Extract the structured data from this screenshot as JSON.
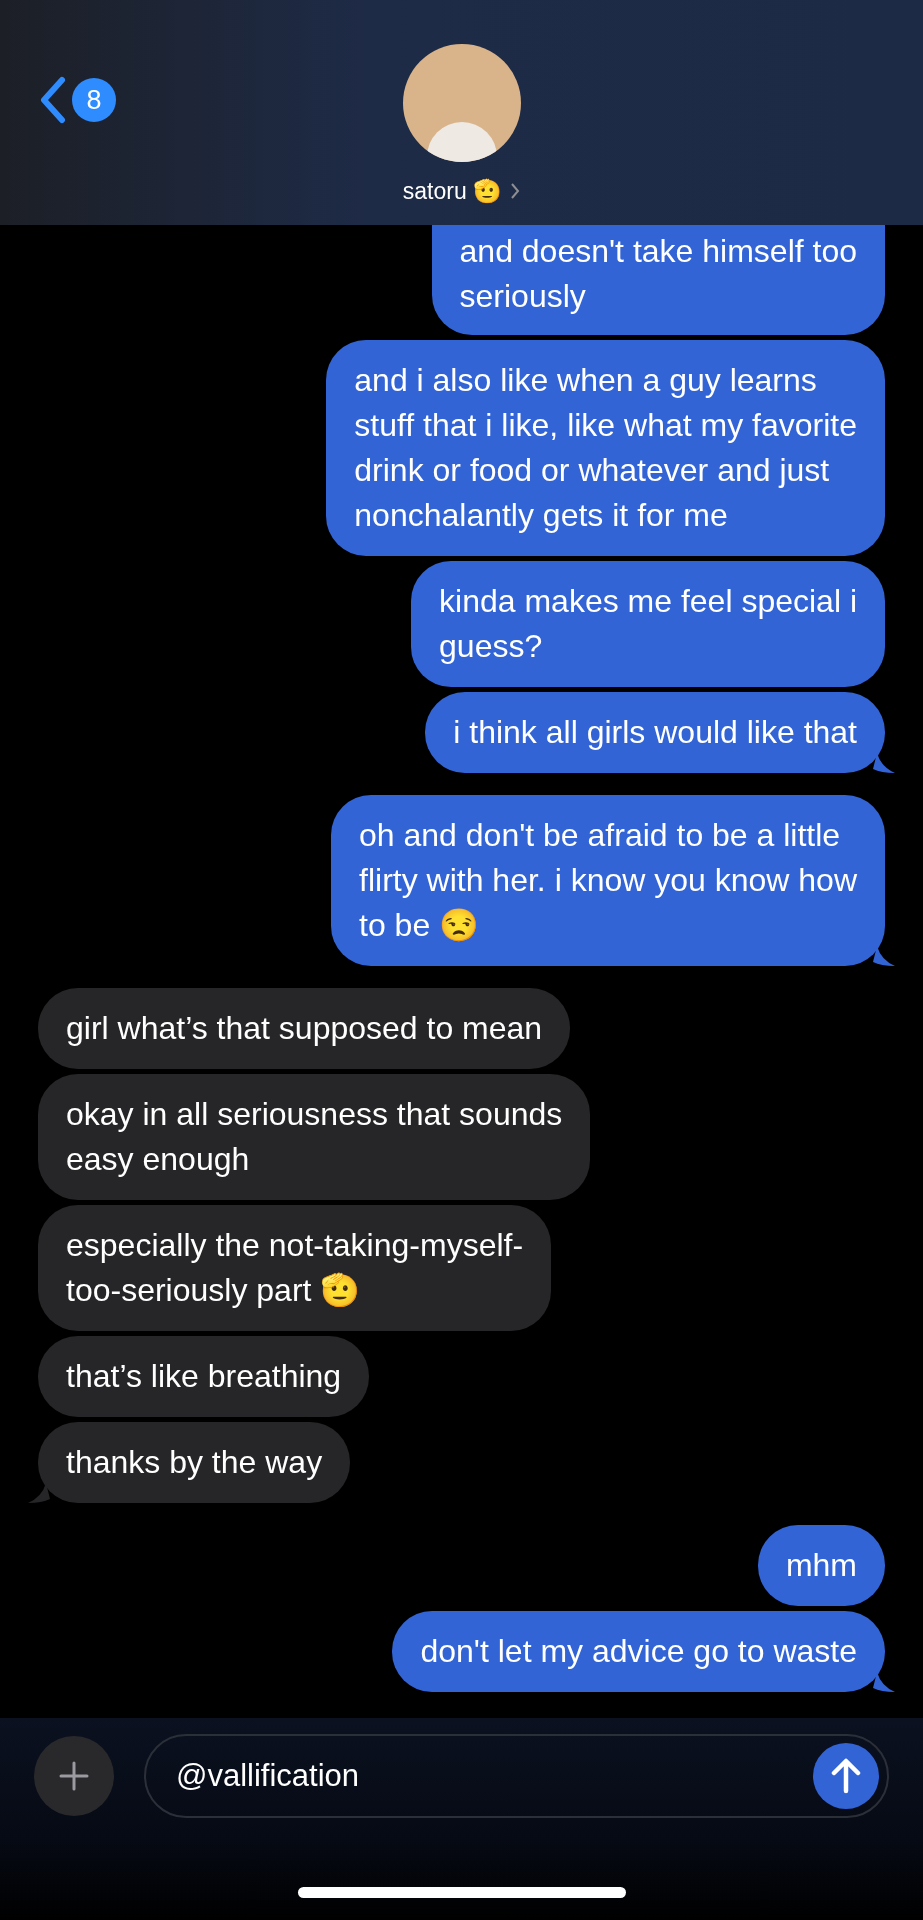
{
  "header": {
    "back_count": "8",
    "contact_name": "satoru 🫡"
  },
  "messages": [
    {
      "kind": "sent",
      "text": "and doesn't take himself too\nseriously",
      "tail": false,
      "cut_top": true
    },
    {
      "kind": "sent",
      "text": "and i also like when a guy learns\nstuff that i like, like what my favorite\ndrink or food or whatever and just\nnonchalantly gets it for me",
      "tail": false
    },
    {
      "kind": "sent",
      "text": "kinda makes me feel special i\nguess?",
      "tail": false
    },
    {
      "kind": "sent",
      "text": "i think all girls would like that",
      "tail": true
    },
    {
      "kind": "sent",
      "text": "oh and don't be afraid to be a little\nflirty with her. i know you know how\nto be 😒",
      "tail": true
    },
    {
      "kind": "received",
      "text": "girl what’s that supposed to mean",
      "tail": false
    },
    {
      "kind": "received",
      "text": "okay in all seriousness that sounds\neasy enough",
      "tail": false
    },
    {
      "kind": "received",
      "text": "especially the not-taking-myself-\ntoo-seriously part 🫡",
      "tail": false
    },
    {
      "kind": "received",
      "text": "that’s like breathing",
      "tail": false
    },
    {
      "kind": "received",
      "text": "thanks by the way",
      "tail": true
    },
    {
      "kind": "sent",
      "text": "mhm",
      "tail": false
    },
    {
      "kind": "sent",
      "text": "don't let my advice go to waste",
      "tail": true
    }
  ],
  "composer": {
    "value": "@vallification"
  }
}
